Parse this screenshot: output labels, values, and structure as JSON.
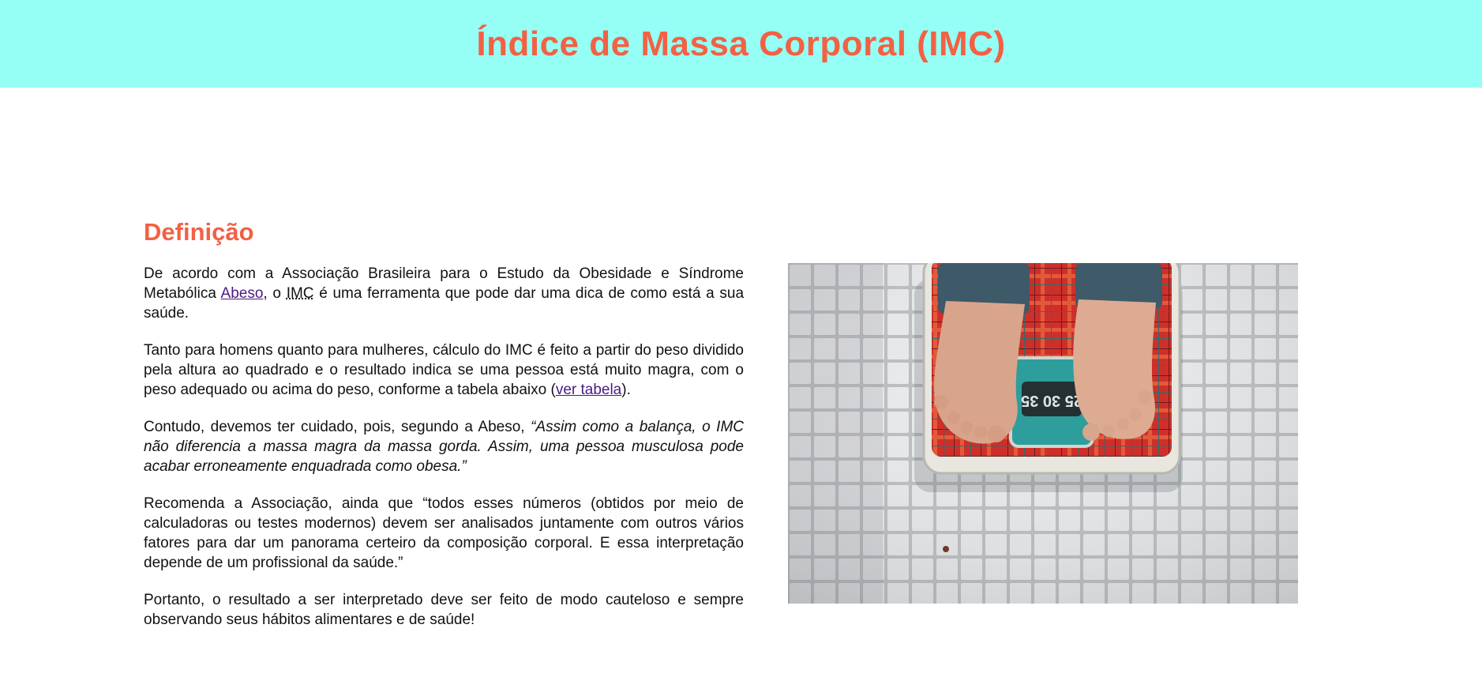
{
  "colors": {
    "header_bg": "#95fff6",
    "accent": "#f26144",
    "link": "#4a1a84",
    "text": "#111111"
  },
  "header": {
    "title": "Índice de Massa Corporal (IMC)"
  },
  "section": {
    "heading": "Definição",
    "p1": {
      "before_link": "De acordo com a Associação Brasileira para o Estudo da Obesidade e Síndrome Metabólica ",
      "link": "Abeso",
      "between": ", o ",
      "abbr": "IMC",
      "after": " é uma ferramenta que pode dar uma dica de como está a sua saúde."
    },
    "p2": {
      "text": "Tanto para homens quanto para mulheres, cálculo do IMC é feito a partir do peso dividido pela altura ao quadrado e o resultado indica se uma pessoa está muito magra, com o peso adequado ou acima do peso, conforme a tabela abaixo (",
      "link": "ver tabela",
      "after": ")."
    },
    "p3": {
      "text": "Contudo, devemos ter cuidado, pois, segundo a Abeso, ",
      "quote": "“Assim como a balança, o IMC não diferencia a massa magra da massa gorda. Assim, uma pessoa musculosa pode acabar erroneamente enquadrada como obesa.”"
    },
    "p4": "Recomenda a Associação, ainda que “todos esses números (obtidos por meio de calculadoras ou testes modernos) devem ser analisados juntamente com outros vários fatores para dar um panorama certeiro da composição corporal. E essa interpretação depende de um profissional da saúde.”",
    "p5": "Portanto, o resultado a ser interpretado deve ser feito de modo cauteloso e sempre observando seus hábitos alimentares e de saúde!"
  },
  "image": {
    "scale_dial": "25 30 35"
  }
}
